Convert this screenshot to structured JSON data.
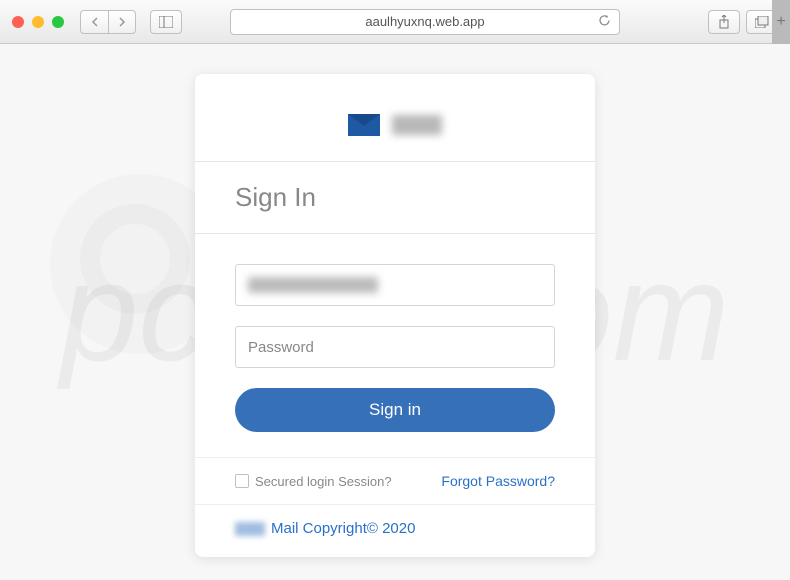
{
  "browser": {
    "url": "aaulhyuxnq.web.app"
  },
  "page": {
    "title": "Sign In",
    "email_value": "",
    "password_placeholder": "Password",
    "signin_button_label": "Sign in",
    "secured_session_label": "Secured login Session?",
    "forgot_password_label": "Forgot Password?",
    "copyright_text": "Mail Copyright© 2020"
  },
  "watermark": "pcrisk.com"
}
